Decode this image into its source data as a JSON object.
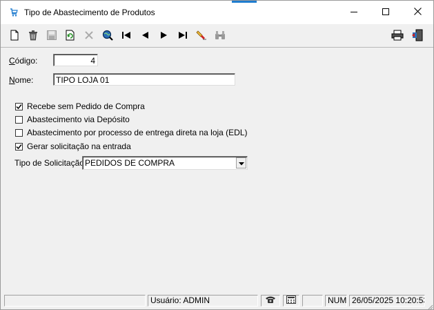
{
  "window": {
    "title": "Tipo de Abastecimento de Produtos"
  },
  "icons": {
    "app": "shopping-cart-icon",
    "toolbar": [
      "new-document-icon",
      "trash-icon",
      "save-icon",
      "refresh-icon",
      "cancel-x-icon",
      "search-globe-icon",
      "first-record-icon",
      "previous-record-icon",
      "next-record-icon",
      "last-record-icon",
      "clear-filter-icon",
      "binoculars-icon",
      "printer-icon",
      "exit-door-icon"
    ]
  },
  "form": {
    "codigo_label": "Código:",
    "codigo_value": "4",
    "nome_label": "Nome:",
    "nome_value": "TIPO LOJA 01",
    "checkboxes": [
      {
        "label": "Recebe sem Pedido de Compra",
        "checked": true
      },
      {
        "label": "Abastecimento via Depósito",
        "checked": false
      },
      {
        "label": "Abastecimento por processo de entrega direta na loja (EDL)",
        "checked": false
      },
      {
        "label": "Gerar solicitação na entrada",
        "checked": true
      }
    ],
    "tipo_solicitacao_label": "Tipo de Solicitação:",
    "tipo_solicitacao_value": "PEDIDOS DE COMPRA"
  },
  "statusbar": {
    "user": "Usuário: ADMIN",
    "num": "NUM",
    "datetime": "26/05/2025 10:20:53"
  }
}
